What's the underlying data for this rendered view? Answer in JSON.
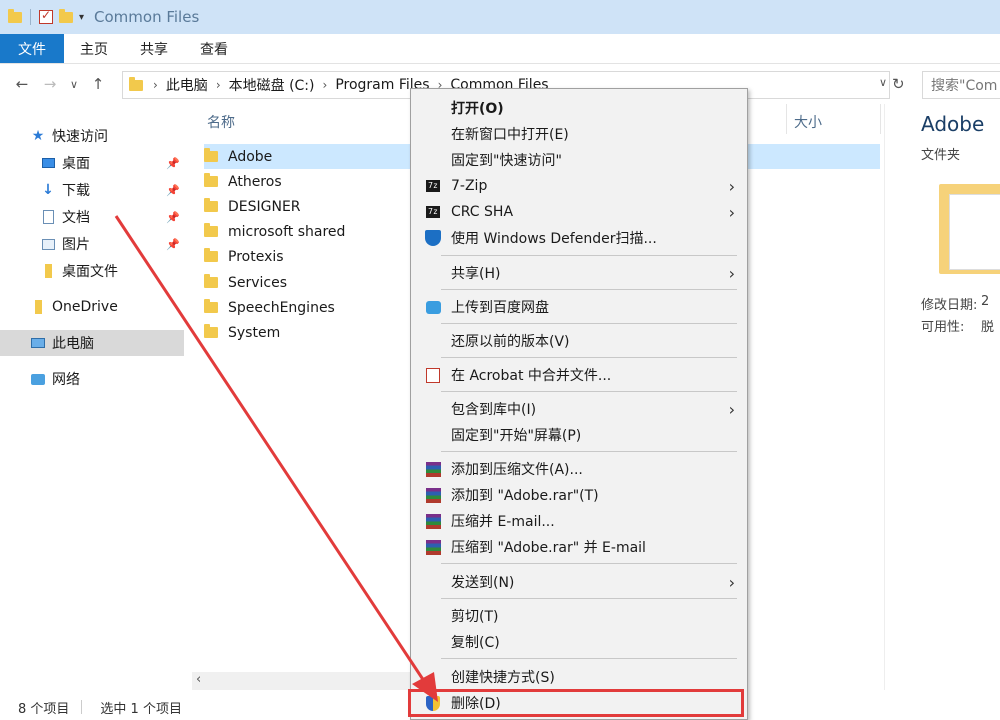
{
  "window": {
    "title": "Common Files"
  },
  "ribbon": {
    "tabs": [
      "文件",
      "主页",
      "共享",
      "查看"
    ]
  },
  "address": {
    "crumbs": [
      "此电脑",
      "本地磁盘 (C:)",
      "Program Files",
      "Common Files"
    ],
    "search_placeholder": "搜索\"Com"
  },
  "nav": {
    "items": [
      {
        "label": "快速访问",
        "icon": "star-icon"
      },
      {
        "label": "桌面",
        "icon": "desktop-icon",
        "pinned": true
      },
      {
        "label": "下载",
        "icon": "download-icon",
        "pinned": true
      },
      {
        "label": "文档",
        "icon": "document-icon",
        "pinned": true
      },
      {
        "label": "图片",
        "icon": "picture-icon",
        "pinned": true
      },
      {
        "label": "桌面文件",
        "icon": "folder-icon"
      },
      {
        "label": "OneDrive",
        "icon": "onedrive-icon"
      },
      {
        "label": "此电脑",
        "icon": "computer-icon",
        "selected": true
      },
      {
        "label": "网络",
        "icon": "network-icon"
      }
    ]
  },
  "filelist": {
    "columns": {
      "name": "名称",
      "size": "大小"
    },
    "files": [
      "Adobe",
      "Atheros",
      "DESIGNER",
      "microsoft shared",
      "Protexis",
      "Services",
      "SpeechEngines",
      "System"
    ],
    "selected": "Adobe"
  },
  "details": {
    "name": "Adobe",
    "type": "文件夹",
    "modified_label": "修改日期:",
    "modified_value": "2",
    "availability_label": "可用性:",
    "availability_value": "脱"
  },
  "status": {
    "count": "8 个项目",
    "selected": "选中 1 个项目"
  },
  "context_menu": {
    "items": [
      {
        "label": "打开(O)",
        "bold": true
      },
      {
        "label": "在新窗口中打开(E)"
      },
      {
        "label": "固定到\"快速访问\""
      },
      {
        "label": "7-Zip",
        "icon": "7zip-icon",
        "submenu": true
      },
      {
        "label": "CRC SHA",
        "icon": "7zip-icon",
        "submenu": true
      },
      {
        "label": "使用 Windows Defender扫描...",
        "icon": "defender-shield-icon"
      },
      {
        "label": "共享(H)",
        "submenu": true
      },
      {
        "label": "上传到百度网盘",
        "icon": "baidu-netdisk-icon"
      },
      {
        "label": "还原以前的版本(V)"
      },
      {
        "label": "在 Acrobat 中合并文件...",
        "icon": "acrobat-icon"
      },
      {
        "label": "包含到库中(I)",
        "submenu": true
      },
      {
        "label": "固定到\"开始\"屏幕(P)"
      },
      {
        "label": "添加到压缩文件(A)...",
        "icon": "winrar-icon"
      },
      {
        "label": "添加到 \"Adobe.rar\"(T)",
        "icon": "winrar-icon"
      },
      {
        "label": "压缩并 E-mail...",
        "icon": "winrar-icon"
      },
      {
        "label": "压缩到 \"Adobe.rar\" 并 E-mail",
        "icon": "winrar-icon"
      },
      {
        "label": "发送到(N)",
        "submenu": true
      },
      {
        "label": "剪切(T)"
      },
      {
        "label": "复制(C)"
      },
      {
        "label": "创建快捷方式(S)"
      },
      {
        "label": "删除(D)",
        "icon": "uac-shield-icon"
      }
    ]
  },
  "colors": {
    "accent": "#1979ca",
    "selection": "#cce8ff",
    "annotation": "#e23b3b"
  }
}
